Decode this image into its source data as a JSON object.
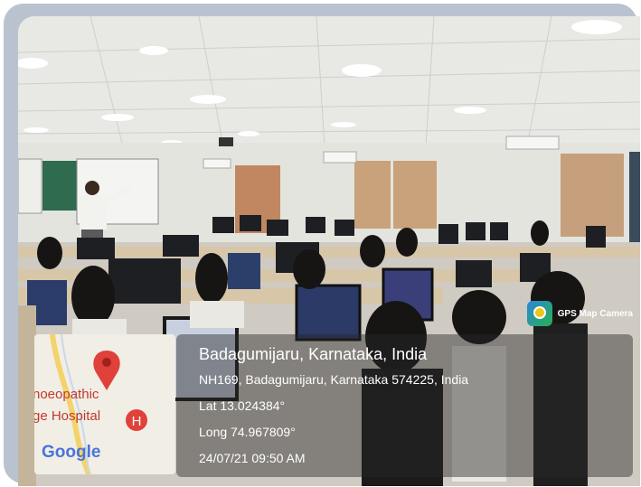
{
  "photo": {
    "description_tag": "computer-lab-classroom"
  },
  "watermark": {
    "label": "GPS Map Camera",
    "icon": "gps-map-camera-icon"
  },
  "map": {
    "label_line1": "noeopathic",
    "label_line2": "ge Hospital",
    "hospital_marker": "H",
    "brand": "Google",
    "pin_color": "#e0413a"
  },
  "location": {
    "title": "Badagumijaru, Karnataka, India",
    "address": "NH169, Badagumijaru, Karnataka 574225, India",
    "lat": "Lat 13.024384°",
    "long": "Long 74.967809°",
    "datetime": "24/07/21 09:50 AM"
  }
}
